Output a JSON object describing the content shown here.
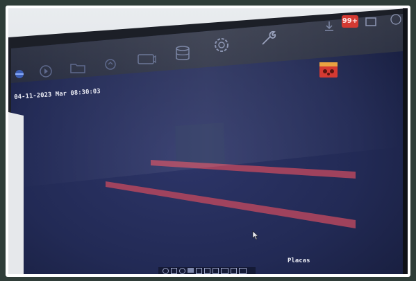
{
  "screen": {
    "timestamp": "04-11-2023 Mar 08:30:03",
    "camera_label": "Placas",
    "notification_count": "99+"
  },
  "toolbar_icons": [
    "live-view-icon",
    "playback-icon",
    "folder-icon",
    "smart-search-icon",
    "camera-icon",
    "storage-icon",
    "settings-icon",
    "maintenance-wrench-icon"
  ],
  "status_icons": [
    "download-icon",
    "alarm-badge-icon",
    "record-icon"
  ],
  "colors": {
    "screen_dark": "#1a2240",
    "screen_mid": "#2b3464",
    "red_line": "#b5475e",
    "alarm_red": "#d43a32",
    "frame_bg": "#2f3d38"
  }
}
